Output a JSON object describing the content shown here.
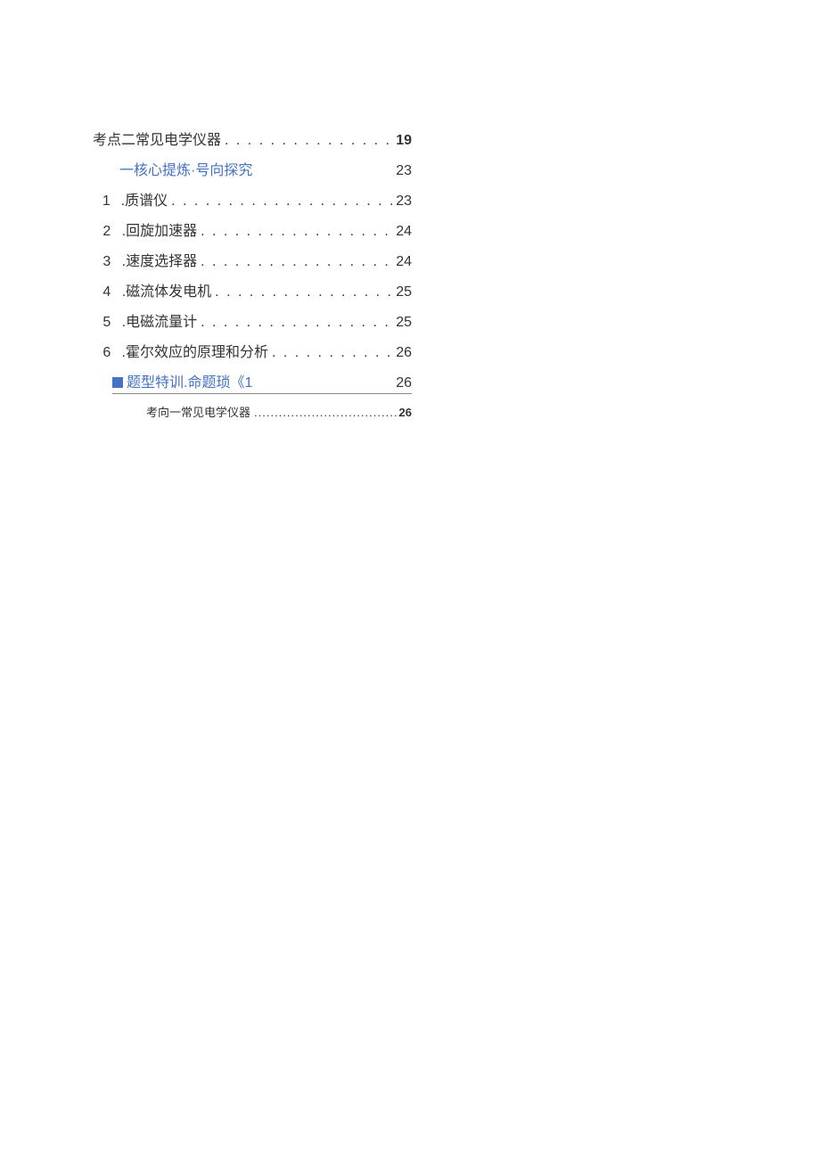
{
  "toc": {
    "main_heading": {
      "label": "考点二常见电学仪器",
      "page": "19"
    },
    "section_a": {
      "label": "一核心提炼·号向探究",
      "page": "23"
    },
    "items": [
      {
        "num": "1",
        "label": ".质谱仪",
        "page": "23"
      },
      {
        "num": "2",
        "label": ".回旋加速器",
        "page": "24"
      },
      {
        "num": "3",
        "label": ".速度选择器",
        "page": "24"
      },
      {
        "num": "4",
        "label": ".磁流体发电机",
        "page": "25"
      },
      {
        "num": "5",
        "label": ".电磁流量计",
        "page": "25"
      },
      {
        "num": "6",
        "label": ".霍尔效应的原理和分析",
        "page": "26"
      }
    ],
    "section_b": {
      "prefix": "题型特训.",
      "suffix": "命题琐《1",
      "page": "26"
    },
    "sub_item": {
      "label": "考向一常见电学仪器",
      "page": "26"
    }
  }
}
